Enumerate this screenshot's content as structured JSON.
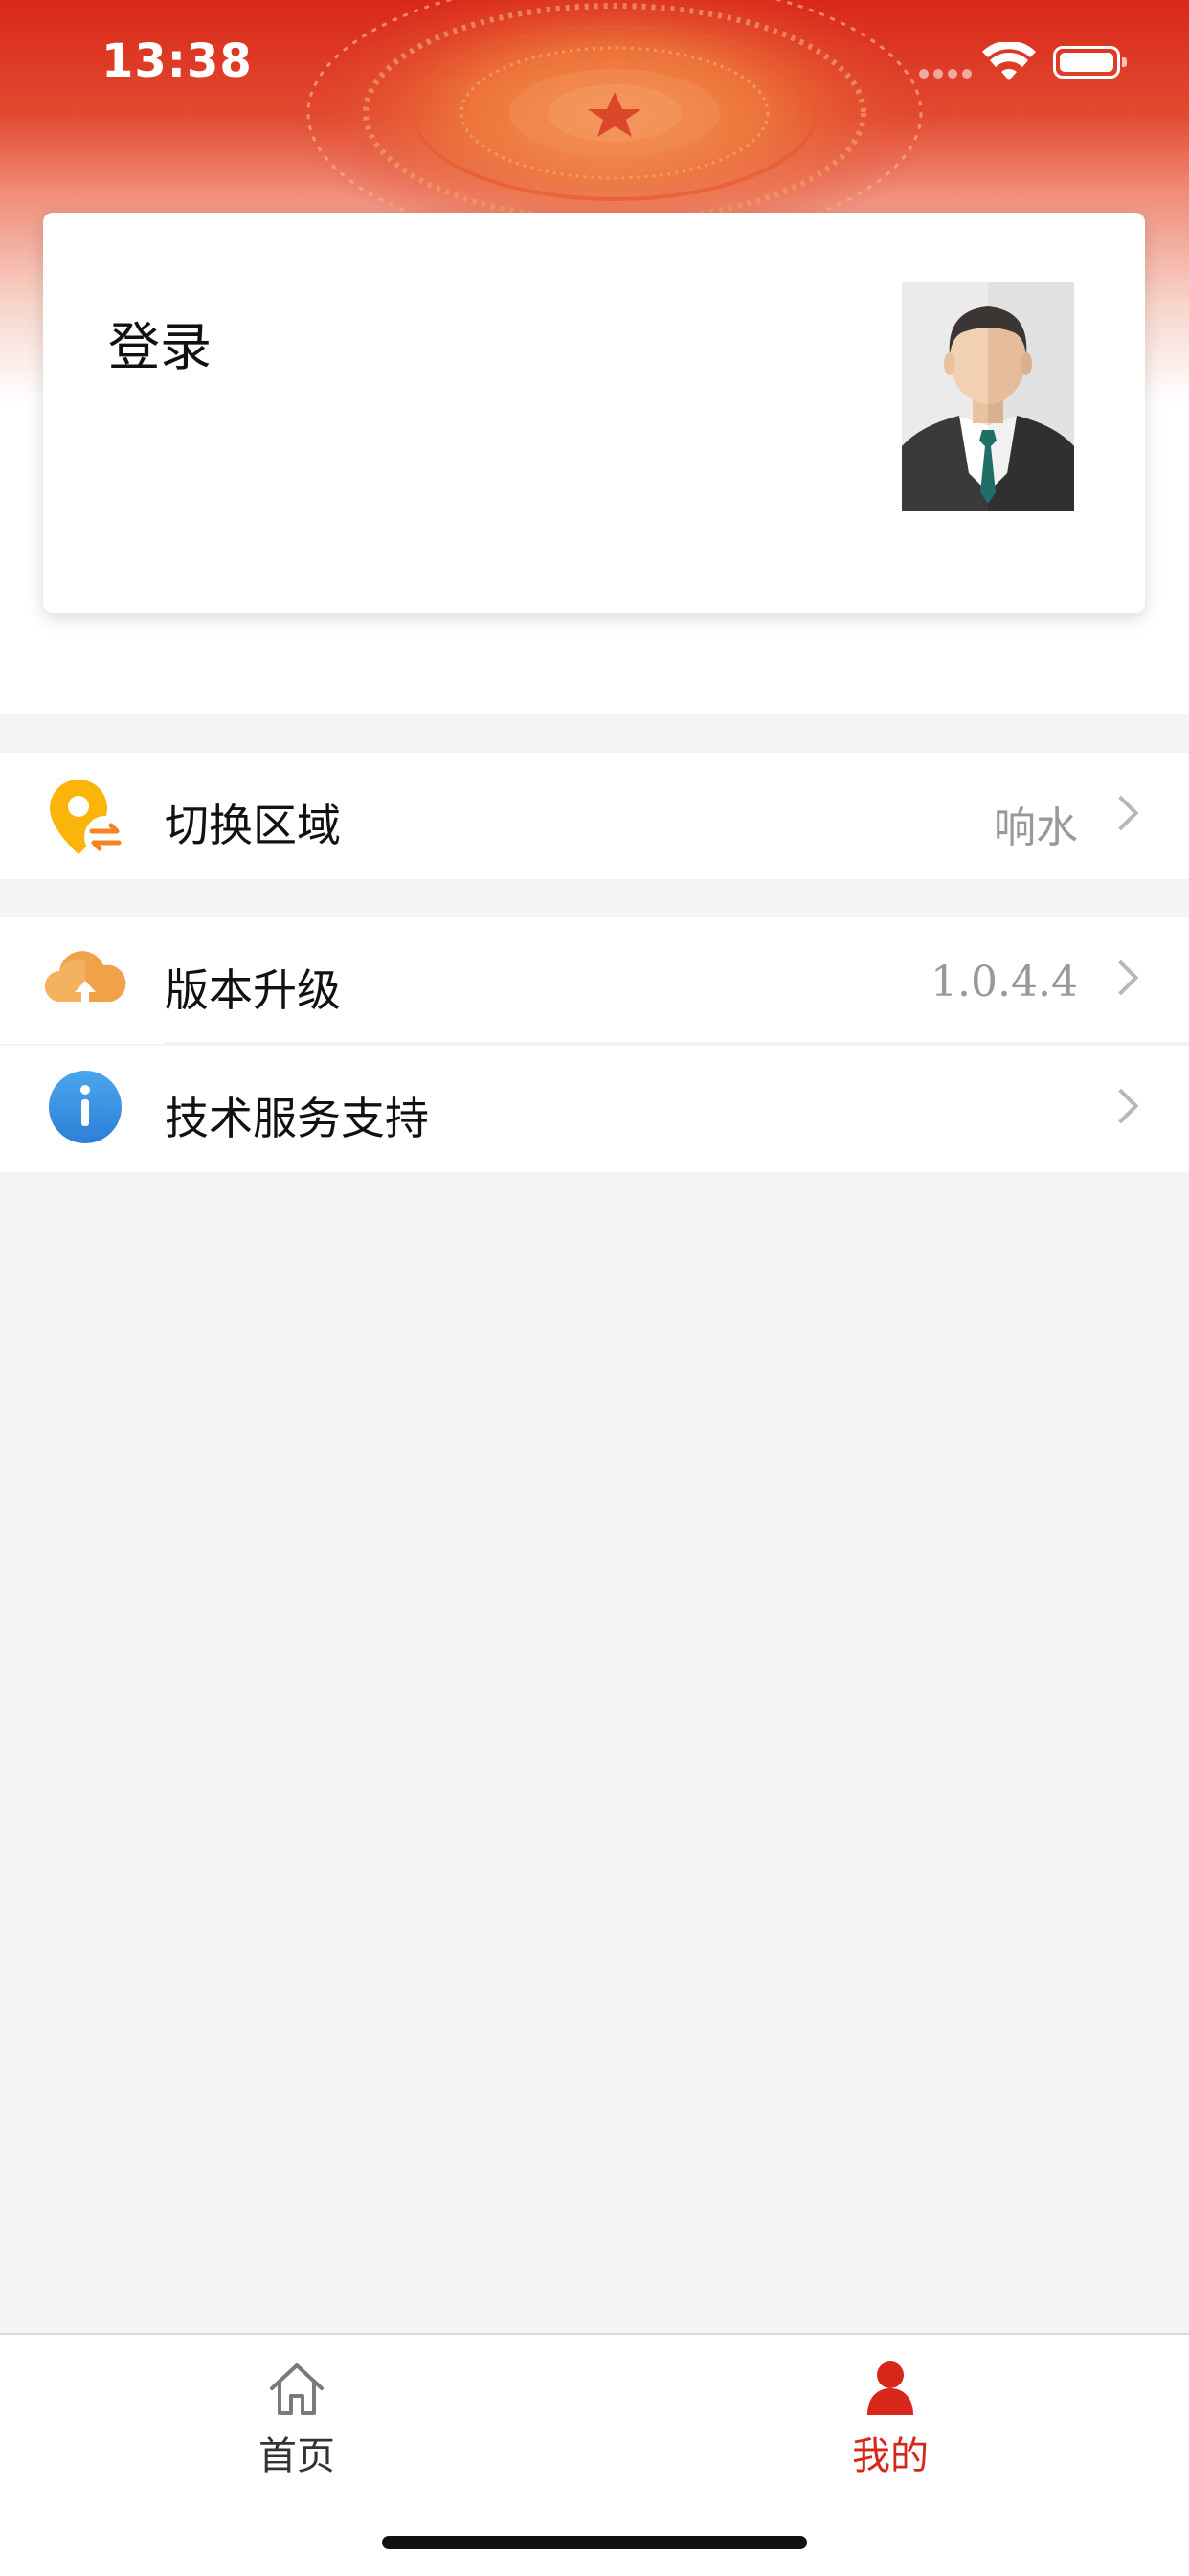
{
  "status_bar": {
    "time": "13:38"
  },
  "colors": {
    "brand_red": "#d7261a",
    "value_gray": "#999999",
    "background": "#f4f4f4"
  },
  "login_card": {
    "label": "登录",
    "avatar_icon": "user-avatar-businessman"
  },
  "menu": {
    "group1": [
      {
        "label": "切换区域",
        "value": "响水",
        "icon": "location-switch-icon"
      }
    ],
    "group2": [
      {
        "label": "版本升级",
        "value": "1.0.4.4",
        "icon": "cloud-upload-icon"
      },
      {
        "label": "技术服务支持",
        "value": "",
        "icon": "info-icon"
      }
    ]
  },
  "tabbar": {
    "home_label": "首页",
    "mine_label": "我的",
    "active_tab": "mine"
  }
}
